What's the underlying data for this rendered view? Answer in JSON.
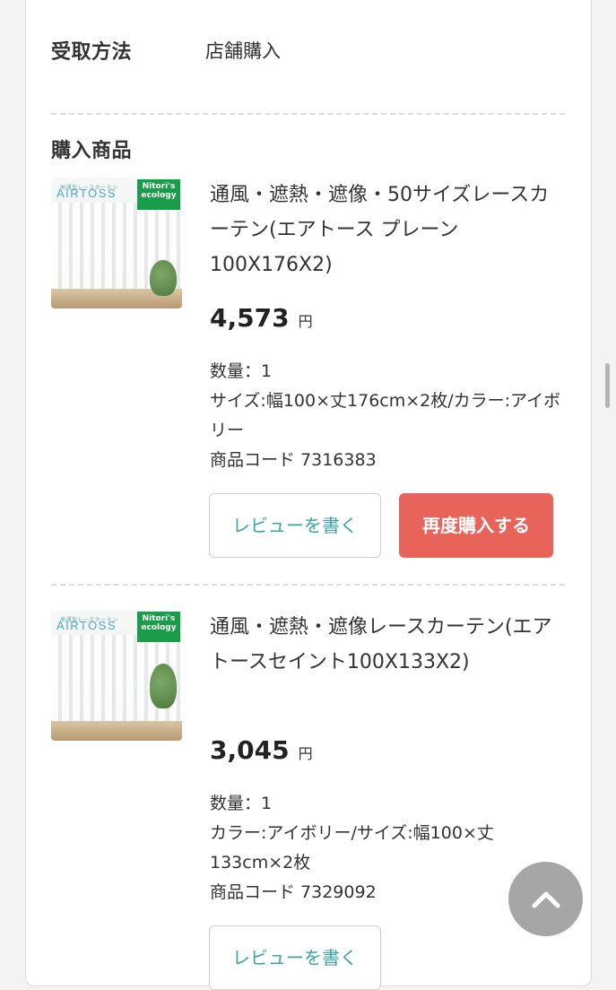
{
  "receive": {
    "label": "受取方法",
    "value": "店舗購入"
  },
  "section": {
    "title": "購入商品"
  },
  "items": [
    {
      "brand_sub": "高通気レースカーテン",
      "brand": "AIRTOSS",
      "badge": "Nitori's ecology",
      "title": "通風・遮熱・遮像・50サイズレースカーテン(エアトース プレーン100X176X2)",
      "price": "4,573",
      "currency": "円",
      "qty": "数量：1",
      "spec": "サイズ:幅100×丈176cm×2枚/カラー:アイボリー",
      "code": "商品コード 7316383",
      "review_label": "レビューを書く",
      "rebuy_label": "再度購入する"
    },
    {
      "brand_sub": "高通気レースカーテン",
      "brand": "AIRTOSS",
      "badge": "Nitori's ecology",
      "title": "通風・遮熱・遮像レースカーテン(エアトースセイント100X133X2)",
      "price": "3,045",
      "currency": "円",
      "qty": "数量：1",
      "spec": "カラー:アイボリー/サイズ:幅100×丈133cm×2枚",
      "code": "商品コード 7329092",
      "review_label": "レビューを書く"
    }
  ],
  "icons": {
    "scroll_top": "chevron-up-icon"
  }
}
